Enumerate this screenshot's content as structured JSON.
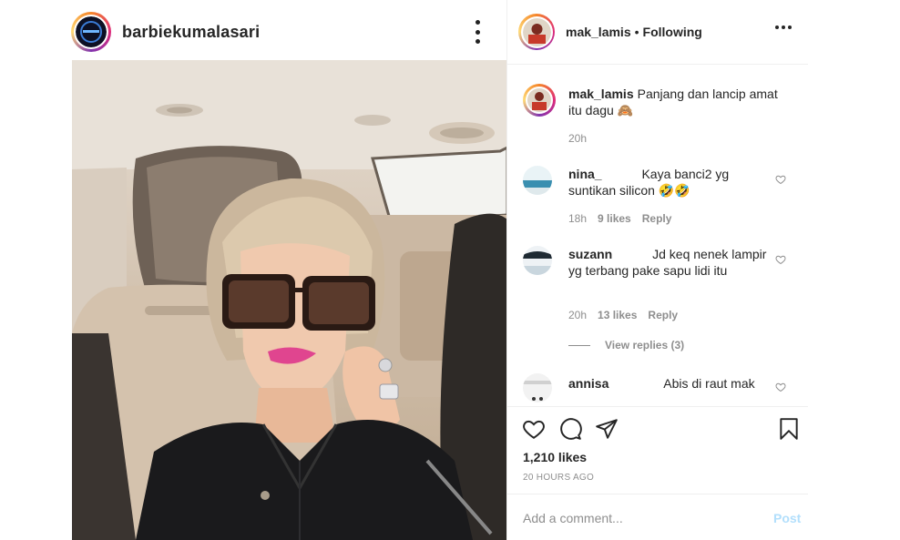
{
  "post": {
    "author": "barbiekumalasari",
    "likes": "1,210 likes",
    "time": "20 HOURS AGO"
  },
  "header": {
    "username": "mak_lamis",
    "separator": "•",
    "follow_state": "Following"
  },
  "comments": [
    {
      "user": "mak_lamis",
      "text": "Panjang dan lancip amat itu dagu 🙈",
      "time": "20h",
      "likes": "",
      "reply": ""
    },
    {
      "user": "nina_",
      "text": "Kaya banci2 yg suntikan silicon 🤣🤣",
      "time": "18h",
      "likes": "9 likes",
      "reply": "Reply"
    },
    {
      "user": "suzann",
      "text": "Jd keq nenek lampir yg terbang pake sapu lidi itu",
      "time": "20h",
      "likes": "13 likes",
      "reply": "Reply"
    },
    {
      "user": "annisa",
      "text": "Abis di raut mak",
      "time": "",
      "likes": "",
      "reply": ""
    }
  ],
  "view_replies": "View replies (3)",
  "composer": {
    "placeholder": "Add a comment...",
    "post_label": "Post"
  },
  "icons": {
    "more": "kebab-icon",
    "like": "heart-icon",
    "comment": "comment-icon",
    "share": "paper-plane-icon",
    "save": "bookmark-icon"
  },
  "colors": {
    "text": "#262626",
    "muted": "#8e8e8e",
    "post_disabled": "#b2dffc",
    "divider": "#efefef",
    "lipstick": "#e0458f"
  }
}
